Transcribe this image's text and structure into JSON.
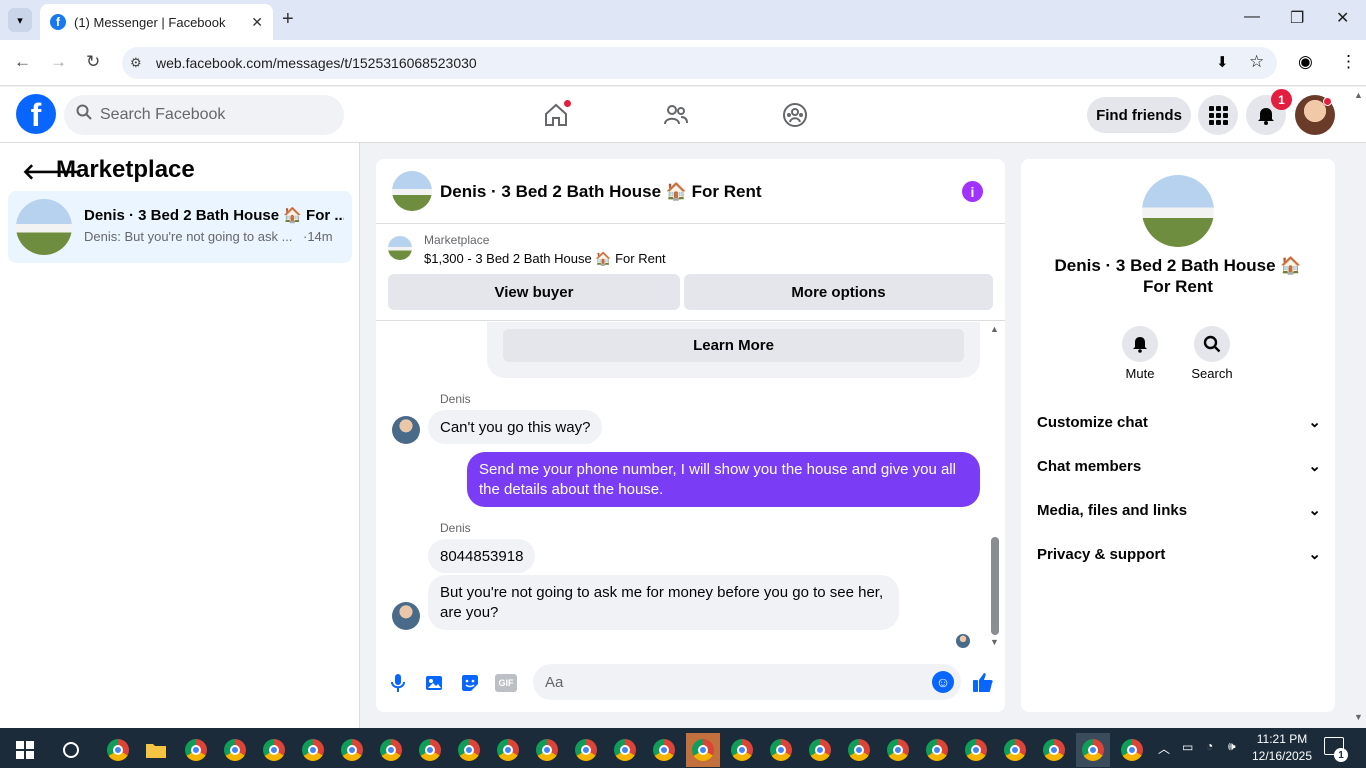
{
  "browser": {
    "tab_title": "(1) Messenger | Facebook",
    "url": "web.facebook.com/messages/t/1525316068523030"
  },
  "fb_header": {
    "search_placeholder": "Search Facebook",
    "find_friends": "Find friends",
    "notification_count": "1"
  },
  "left_panel": {
    "title": "Marketplace",
    "conversation": {
      "name": "Denis · 3 Bed 2 Bath House 🏠 For ...",
      "last_message": "Denis: But you're not going to ask ...",
      "time": "·14m"
    }
  },
  "chat": {
    "title": "Denis · 3 Bed 2 Bath House 🏠 For Rent",
    "listing_source": "Marketplace",
    "listing_title": "$1,300 - 3 Bed 2 Bath House 🏠 For Rent",
    "view_buyer": "View buyer",
    "more_options": "More options",
    "learn_more": "Learn More",
    "messages": [
      {
        "sender": "Denis",
        "text": "Can't you go this way?"
      },
      {
        "sender": "me",
        "text": "Send me your phone number, I will show you the house and give you all the details about the house."
      },
      {
        "sender": "Denis",
        "text": "8044853918"
      },
      {
        "sender": "Denis",
        "text": "But you're not going to ask me for money before you go to see her, are you?"
      }
    ],
    "input_placeholder": "Aa",
    "gif_label": "GIF"
  },
  "right_panel": {
    "title": "Denis · 3 Bed 2 Bath House 🏠 For Rent",
    "mute": "Mute",
    "search": "Search",
    "sections": [
      "Customize chat",
      "Chat members",
      "Media, files and links",
      "Privacy & support"
    ]
  },
  "taskbar": {
    "time": "11:21 PM",
    "date": "12/16/2025",
    "notif_count": "1"
  },
  "colors": {
    "fb_blue": "#0866ff",
    "outgoing_bubble": "#7a3cf5",
    "info_purple": "#a033ff",
    "badge_red": "#e41e3f"
  }
}
